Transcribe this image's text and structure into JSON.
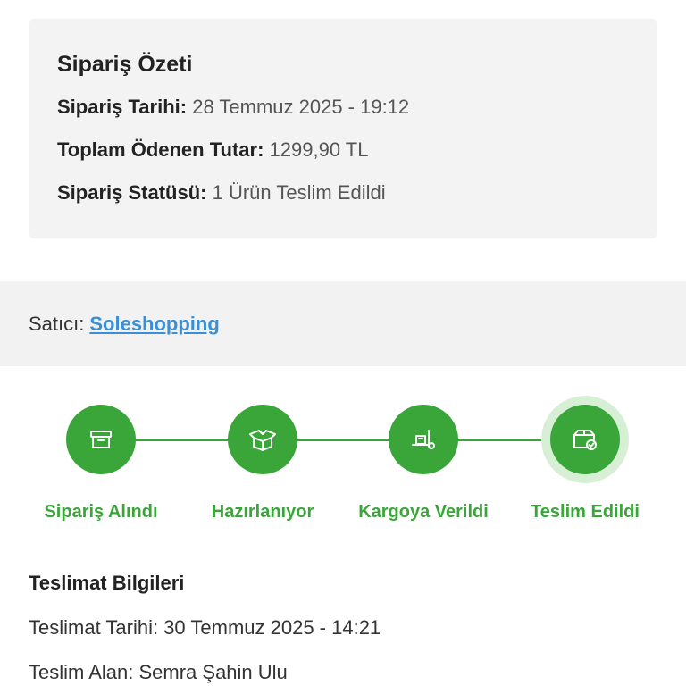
{
  "summary": {
    "title": "Sipariş Özeti",
    "rows": [
      {
        "label": "Sipariş Tarihi:",
        "value": "28 Temmuz 2025 - 19:12"
      },
      {
        "label": "Toplam Ödenen Tutar:",
        "value": "1299,90 TL"
      },
      {
        "label": "Sipariş Statüsü:",
        "value": "1 Ürün Teslim Edildi"
      }
    ]
  },
  "seller": {
    "label": "Satıcı:",
    "name": "Soleshopping"
  },
  "tracker": {
    "accent_color": "#3aa63a",
    "steps": [
      {
        "label": "Sipariş Alındı",
        "icon": "archive-box-icon"
      },
      {
        "label": "Hazırlanıyor",
        "icon": "open-package-icon"
      },
      {
        "label": "Kargoya Verildi",
        "icon": "hand-truck-icon"
      },
      {
        "label": "Teslim Edildi",
        "icon": "package-check-icon"
      }
    ],
    "active_step": 4
  },
  "delivery": {
    "title": "Teslimat Bilgileri",
    "date_line": "Teslimat Tarihi: 30 Temmuz 2025 - 14:21",
    "receiver_line": "Teslim Alan: Semra Şahin Ulu"
  }
}
